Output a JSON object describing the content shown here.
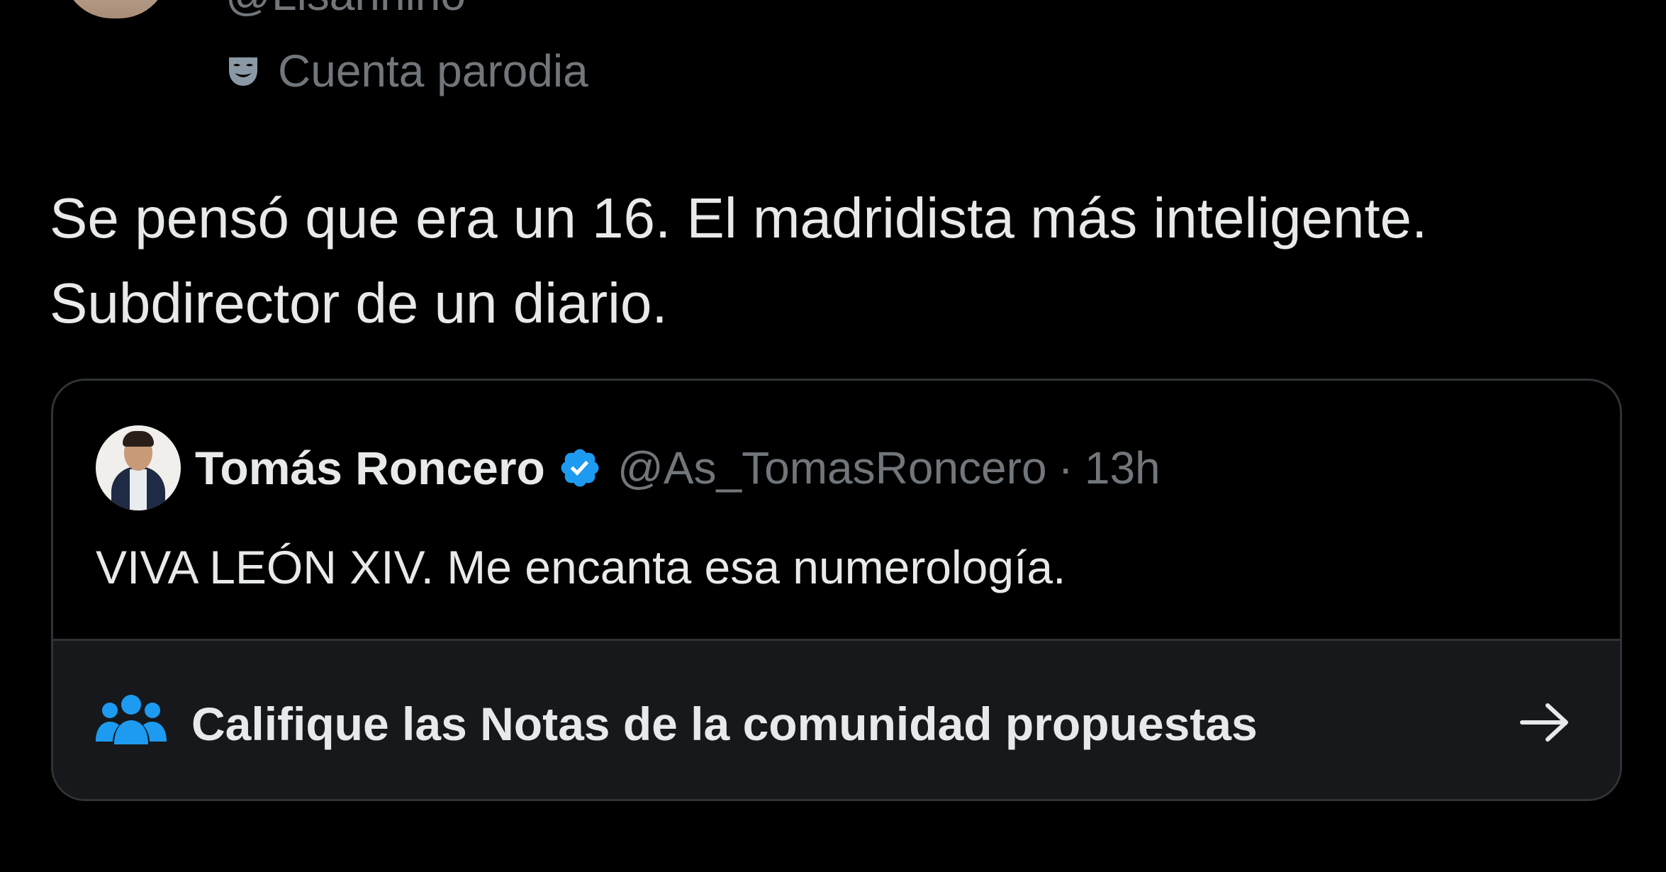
{
  "author": {
    "handle": "@Lisannino",
    "parody_label": "Cuenta parodia",
    "parody_icon": "theater-mask-icon"
  },
  "tweet": {
    "lines": [
      "Se pensó que era un 16. El madridista más inteligente.",
      "Subdirector de un diario."
    ]
  },
  "quoted_tweet": {
    "name": "Tomás Roncero",
    "verified_icon": "verified-badge-icon",
    "handle": "@As_TomasRoncero",
    "separator": "·",
    "time": "13h",
    "text": "VIVA LEÓN XIV. Me encanta esa numerología."
  },
  "community_notes": {
    "icon": "people-group-icon",
    "label": "Califique las Notas de la comunidad propuestas",
    "arrow_icon": "arrow-right-icon"
  },
  "colors": {
    "background": "#000000",
    "text_primary": "#e7e9ea",
    "text_secondary": "#71767b",
    "accent_blue": "#1d9bf0",
    "border": "#2f3336",
    "notes_bar": "#16181c"
  }
}
